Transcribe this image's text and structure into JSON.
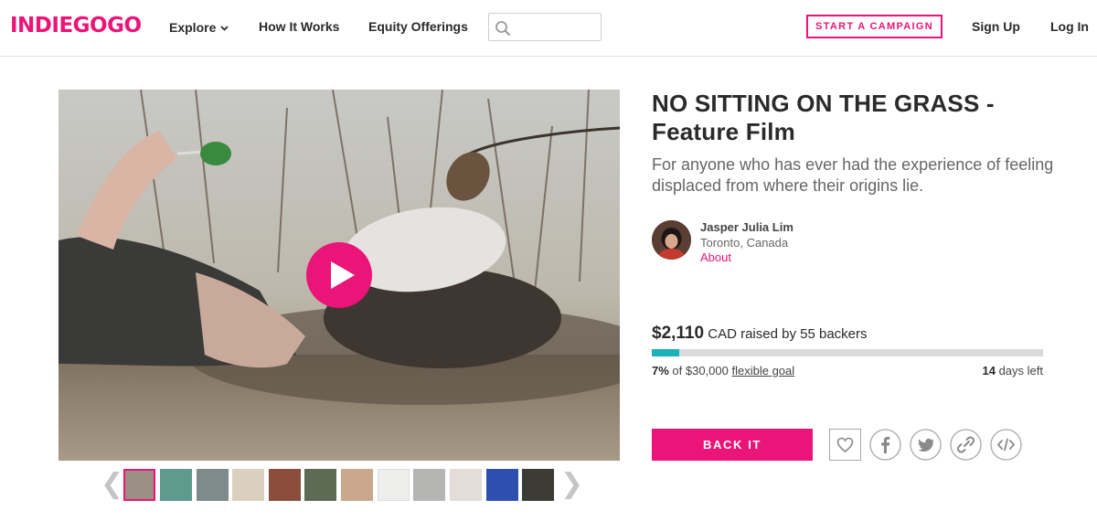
{
  "header": {
    "logo": "INDIEGOGO",
    "nav": {
      "explore": "Explore",
      "how_it_works": "How It Works",
      "equity_offerings": "Equity Offerings"
    },
    "search": {
      "placeholder": "",
      "value": ""
    },
    "start_campaign": "START A CAMPAIGN",
    "sign_up": "Sign Up",
    "log_in": "Log In"
  },
  "campaign": {
    "title_line1": "NO SITTING ON THE GRASS -",
    "title_line2": "Feature Film",
    "tagline": "For anyone who has ever had the experience of feeling displaced from where their origins lie.",
    "owner": {
      "name": "Jasper Julia Lim",
      "location": "Toronto, Canada",
      "about": "About"
    },
    "funding": {
      "amount": "$2,110",
      "raised_text": "CAD raised by 55 backers",
      "percent_label": "7%",
      "percent_value": 7,
      "of_goal": "of $30,000",
      "goal_type": "flexible goal",
      "days": "14",
      "days_text": "days left"
    },
    "back_it": "BACK IT"
  },
  "media": {
    "thumbnail_count": 12,
    "active_thumbnail": 1,
    "prev_arrow": "❮",
    "next_arrow": "❯"
  },
  "share_icons": [
    "heart-icon",
    "facebook-icon",
    "twitter-icon",
    "link-icon",
    "embed-icon"
  ],
  "colors": {
    "brand": "#eb1478",
    "progress": "#1ab2b8",
    "track": "#dadada",
    "text": "#2a2a2a"
  }
}
